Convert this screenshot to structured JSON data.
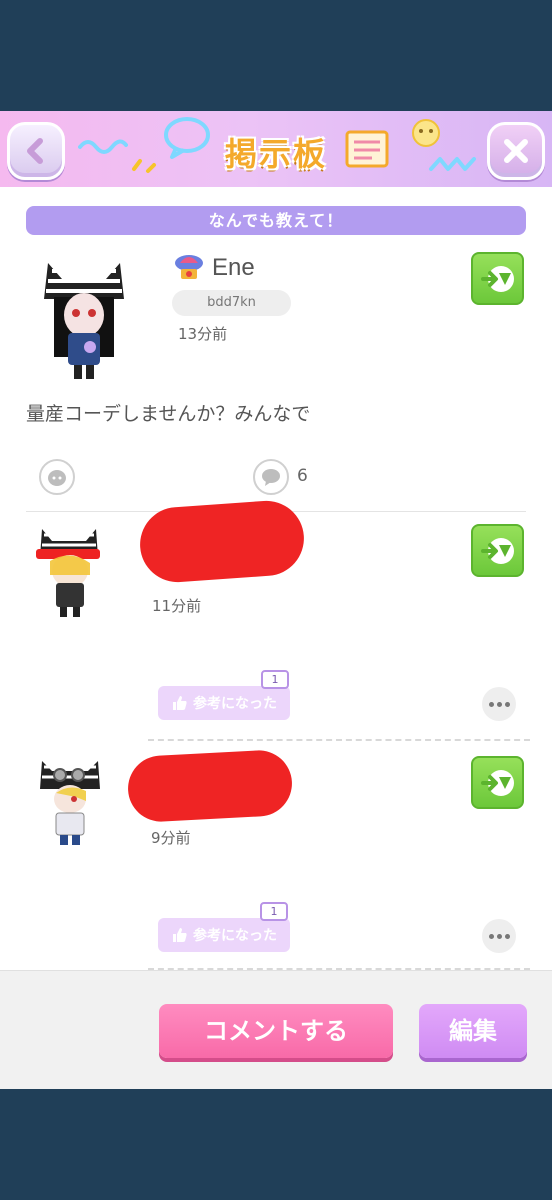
{
  "header": {
    "title": "掲示板",
    "back_icon": "chevron-left-icon",
    "close_icon": "close-icon"
  },
  "topic": {
    "label": "なんでも教えて！"
  },
  "post": {
    "author": "Ene",
    "user_id": "bdd7kn",
    "time": "13分前",
    "text": "量産コーデしませんか？みんなで",
    "comment_count": "6"
  },
  "comments": [
    {
      "time": "11分前",
      "helpful_label": "参考になった",
      "helpful_count": "1"
    },
    {
      "time": "9分前",
      "helpful_label": "参考になった",
      "helpful_count": "1"
    }
  ],
  "footer": {
    "comment_label": "コメントする",
    "edit_label": "編集"
  },
  "colors": {
    "background": "#203f58",
    "topic": "#b29cf0",
    "share_green": "#7fd246",
    "comment_pink": "#f878b2",
    "edit_purple": "#d898f6",
    "title_orange": "#f4a92b"
  }
}
